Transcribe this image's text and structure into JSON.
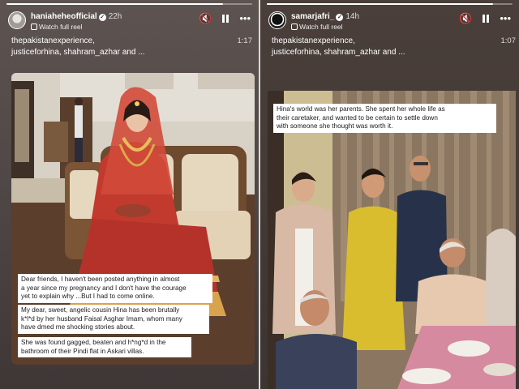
{
  "left_story": {
    "progress": 0.88,
    "username": "haniaheheofficial",
    "time": "22h",
    "watch_label": "Watch full reel",
    "tags_line1": "thepakistanexperience,",
    "tags_line2": "justiceforhina, shahram_azhar and ...",
    "duration": "1:17",
    "captions": [
      "Dear friends, I haven't been posted anything in almost",
      "a year since my pregnancy and I don't have the courage",
      "yet to explain why ...But I had to come online.",
      "My dear, sweet, angelic cousin Hina has been brutally",
      "k*l*d by her husband Faisal Asghar Imam, whom many",
      "have dmed me shocking stories about.",
      "She was found gagged, beaten and h*ng*d in the",
      "bathroom of their Pindi flat in Askari villas."
    ]
  },
  "right_story": {
    "progress": 0.92,
    "username": "samarjafri_",
    "time": "14h",
    "watch_label": "Watch full reel",
    "tags_line1": "thepakistanexperience,",
    "tags_line2": "justiceforhina, shahram_azhar and ...",
    "duration": "1:07",
    "captions": [
      "Hina's world was her parents. She spent her whole life as",
      "their caretaker, and wanted to be certain to settle down",
      "with someone she thought was worth it."
    ]
  },
  "icons": {
    "mute": "speaker-muted-icon",
    "pause": "pause-icon",
    "more": "more-options-icon"
  }
}
